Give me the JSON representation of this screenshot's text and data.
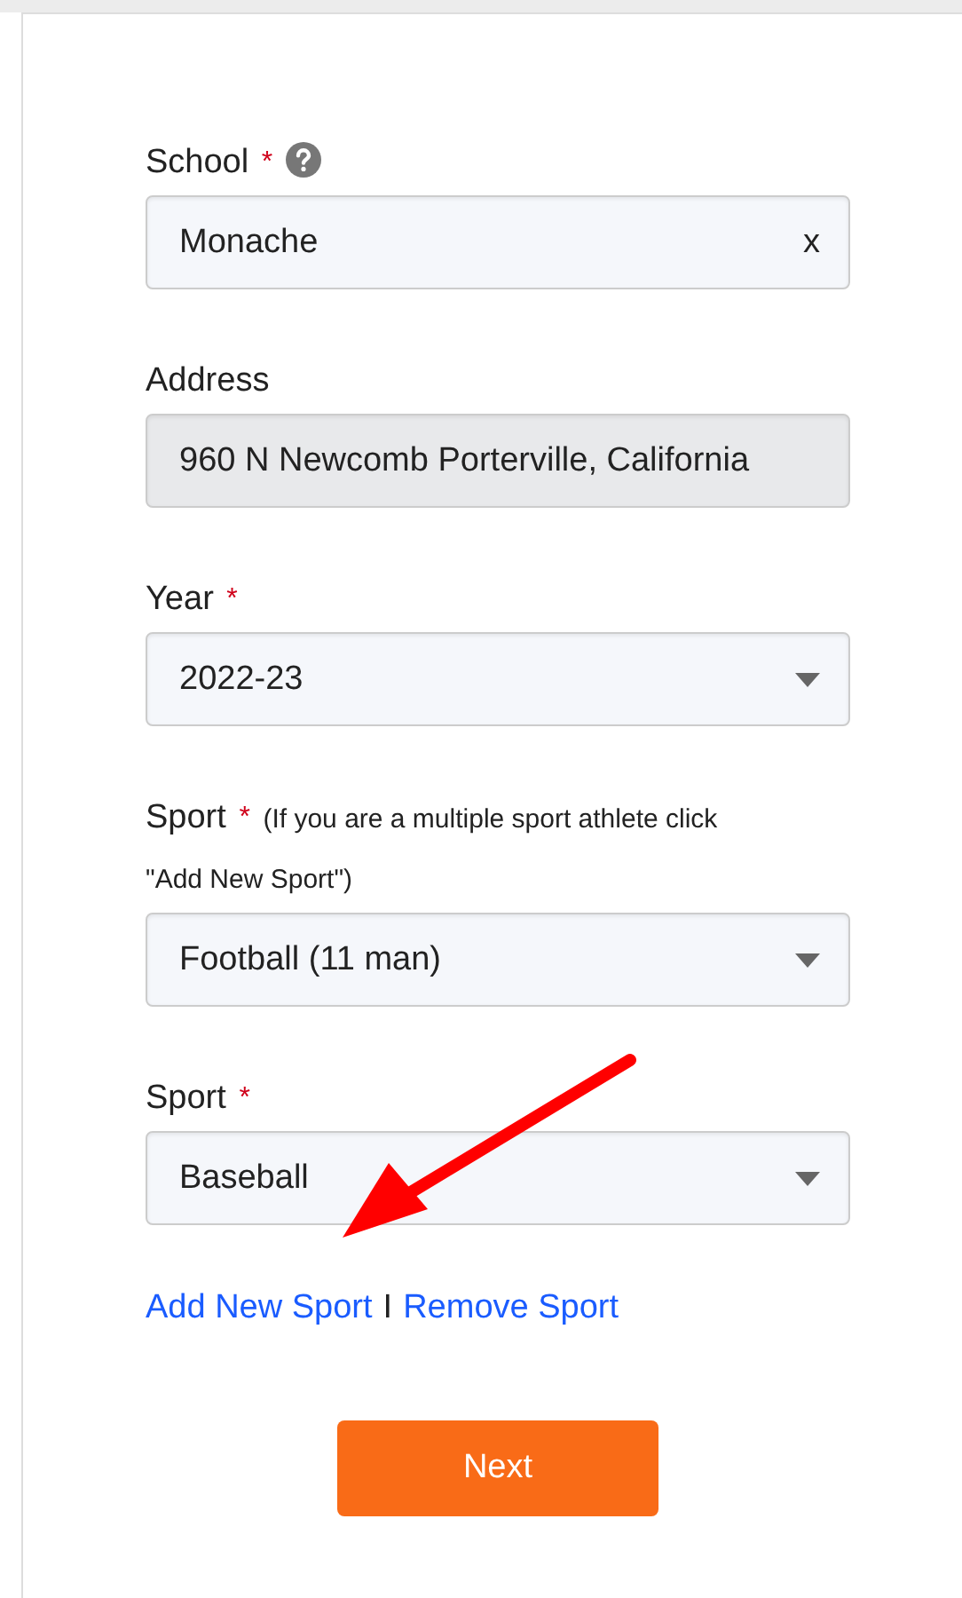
{
  "fields": [
    {
      "kind": "text",
      "label": "School",
      "required_mark": "*",
      "help": true,
      "value": "Monache",
      "clear": "x"
    },
    {
      "kind": "readonly",
      "label": "Address",
      "value": "960 N Newcomb Porterville, California"
    },
    {
      "kind": "select",
      "label": "Year",
      "required_mark": "*",
      "value": "2022-23"
    },
    {
      "kind": "select",
      "label": "Sport",
      "required_mark": "*",
      "note_lines": [
        "(If you are a multiple sport athlete click",
        "\"Add New Sport\")"
      ],
      "value": "Football (11 man)"
    },
    {
      "kind": "select",
      "label": "Sport",
      "required_mark": "*",
      "value": "Baseball"
    }
  ],
  "links": {
    "add": "Add New Sport",
    "separator": "I",
    "remove": "Remove Sport"
  },
  "next_button": "Next"
}
